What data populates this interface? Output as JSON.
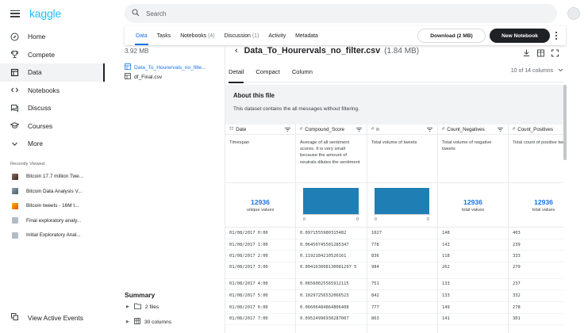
{
  "brand": {
    "logo_text": "kaggle",
    "accent": "#20beff"
  },
  "sidebar": {
    "nav": [
      {
        "label": "Home",
        "icon": "compass-icon"
      },
      {
        "label": "Compete",
        "icon": "trophy-icon"
      },
      {
        "label": "Data",
        "icon": "table-icon",
        "active": true
      },
      {
        "label": "Notebooks",
        "icon": "code-icon"
      },
      {
        "label": "Discuss",
        "icon": "comments-icon"
      },
      {
        "label": "Courses",
        "icon": "graduation-cap-icon"
      },
      {
        "label": "More",
        "icon": "chevron-down-icon"
      }
    ],
    "recently_viewed_title": "Recently Viewed",
    "recent": [
      "Bitcoin 17.7 million Twe...",
      "Bitcoin Data Analysis V...",
      "Bitcoin tweets - 16M t...",
      "Final exploratory analy...",
      "Initial Exploratory Anal..."
    ],
    "view_active_events": "View Active Events"
  },
  "search": {
    "placeholder": "Search"
  },
  "tabs": [
    {
      "label": "Data",
      "count": "",
      "active": true
    },
    {
      "label": "Tasks",
      "count": ""
    },
    {
      "label": "Notebooks",
      "count": "(4)"
    },
    {
      "label": "Discussion",
      "count": "(1)"
    },
    {
      "label": "Activity",
      "count": ""
    },
    {
      "label": "Metadata",
      "count": ""
    }
  ],
  "actions": {
    "download": "Download (2 MB)",
    "new_notebook": "New Notebook"
  },
  "files": {
    "total_size": "3.92 MB",
    "items": [
      {
        "name": "Data_To_Hourervals_no_filte...",
        "selected": true
      },
      {
        "name": "df_Final.csv",
        "selected": false
      }
    ]
  },
  "summary": {
    "title": "Summary",
    "items": [
      {
        "label": "2 files",
        "icon": "folder-icon"
      },
      {
        "label": "30 columns",
        "icon": "table-icon"
      }
    ]
  },
  "detail": {
    "file_title": "Data_To_Hourervals_no_filter.csv",
    "file_size": "(1.84 MB)",
    "view_tabs": [
      "Detail",
      "Compact",
      "Column"
    ],
    "column_count": "10 of 14 columns",
    "about_title": "About this file",
    "about_text": "This dataset contains the all messages without filtering."
  },
  "columns": [
    {
      "type": "date",
      "name": "Date",
      "desc": "Timespan",
      "stat_value": "12936",
      "stat_label": "unique values",
      "hist": false,
      "cells": [
        "01/08/2017 0:00",
        "01/08/2017 1:00",
        "01/08/2017 2:00",
        "01/08/2017 3:00",
        "01/08/2017 4:00",
        "01/08/2017 5:00",
        "01/08/2017 6:00",
        "01/08/2017 7:00"
      ]
    },
    {
      "type": "#",
      "name": "Compound_Score",
      "desc": "Average of all sentiment scores. It is very small because the amount of neutrals dilutes the sentiment",
      "stat_value": "",
      "stat_label": "",
      "hist": true,
      "hist_min": "0",
      "hist_max": "0",
      "cells": [
        "0.0971555980315482",
        "0.06450745501285347",
        "0.1192184210526161",
        "0.004163008130081297 5",
        "0.06560025565912115",
        "0.10297256532066523",
        "0.06606484864806408",
        "0.09524996930287007"
      ]
    },
    {
      "type": "#",
      "name": "n",
      "desc": "Total volume of tweets",
      "stat_value": "",
      "stat_label": "",
      "hist": true,
      "hist_min": "0",
      "hist_max": "0",
      "cells": [
        "1027",
        "778",
        "836",
        "984",
        "751",
        "842",
        "777",
        "863"
      ]
    },
    {
      "type": "#",
      "name": "Count_Negatives",
      "desc": "Total volume of negative tweets",
      "stat_value": "12936",
      "stat_label": "total values",
      "hist": false,
      "cells": [
        "148",
        "143",
        "118",
        "262",
        "133",
        "133",
        "149",
        "141"
      ]
    },
    {
      "type": "#",
      "name": "Count_Positives",
      "desc": "Total count of positive tweets",
      "stat_value": "12936",
      "stat_label": "total values",
      "hist": false,
      "cells": [
        "403",
        "239",
        "333",
        "279",
        "237",
        "332",
        "278",
        "301"
      ]
    }
  ],
  "colors": {
    "hist_bar": "#1f7fb4",
    "link": "#1a73e8"
  }
}
